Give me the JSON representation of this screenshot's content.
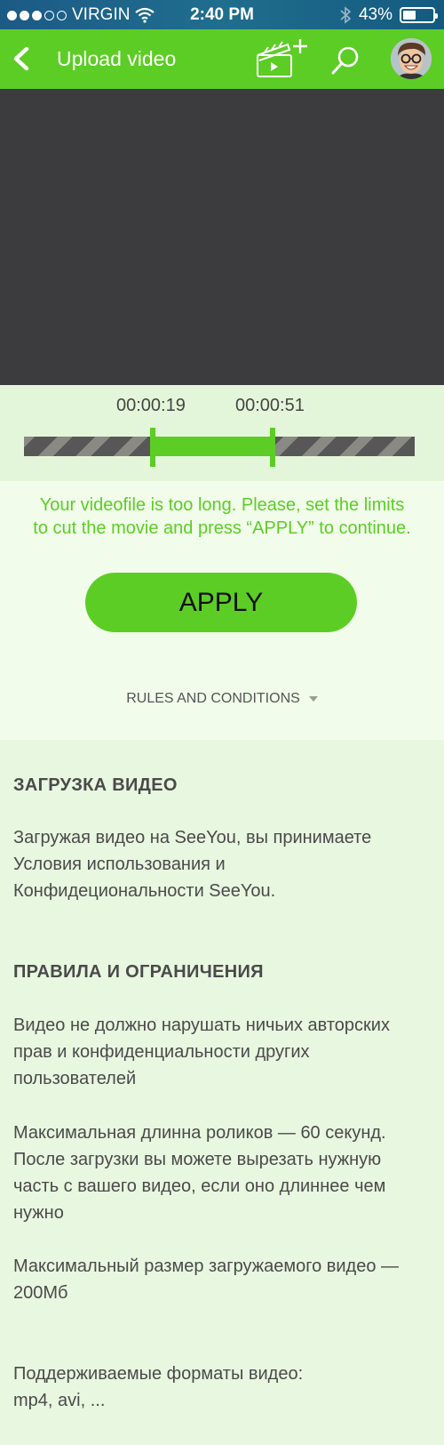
{
  "status_bar": {
    "carrier": "VIRGIN",
    "time": "2:40 PM",
    "battery": "43%",
    "battery_level": 0.43,
    "signal_bars": 3,
    "icons": [
      "wifi-icon",
      "bluetooth-icon",
      "battery-icon"
    ]
  },
  "app_bar": {
    "title": "Upload video",
    "icons": [
      "back-arrow-icon",
      "add-video-clapper-icon",
      "search-icon",
      "avatar"
    ]
  },
  "trim": {
    "start_time": "00:00:19",
    "end_time": "00:00:51",
    "selection_start_fraction": 0.325,
    "selection_end_fraction": 0.636
  },
  "message": {
    "line1": "Your videofile is too long. Please, set the limits",
    "line2": "to cut the movie and press “APPLY” to continue."
  },
  "apply_label": "APPLY",
  "rules_label": "RULES AND CONDITIONS",
  "content": {
    "heading1": "ЗАГРУЗКА ВИДЕО",
    "p1_l1": "Загружая видео на SeeYou, вы принимаете",
    "p1_l2": "Условия использования и",
    "p1_l3": "Конфидециональности SeeYou.",
    "heading2": "ПРАВИЛА И ОГРАНИЧЕНИЯ",
    "p2_l1": "Видео не должно нарушать ничьих авторских",
    "p2_l2": "прав и конфиденциальности других",
    "p2_l3": "пользователей",
    "p3_l1": "Максимальная длинна роликов — 60 секунд.",
    "p3_l2": "После загрузки вы можете вырезать нужную",
    "p3_l3": "часть с вашего видео, если оно длиннее чем",
    "p3_l4": "нужно",
    "p4_l1": "Максимальный размер загружаемого видео —",
    "p4_l2": "200Мб",
    "p5_l1": "Поддерживаемые форматы видео:",
    "p5_l2": "mp4, avi, ..."
  },
  "colors": {
    "accent": "#5ccd25",
    "status_bar": "#1c5a86",
    "video_bg": "#3c3b3d",
    "page_bg": "#e8f7e0"
  }
}
